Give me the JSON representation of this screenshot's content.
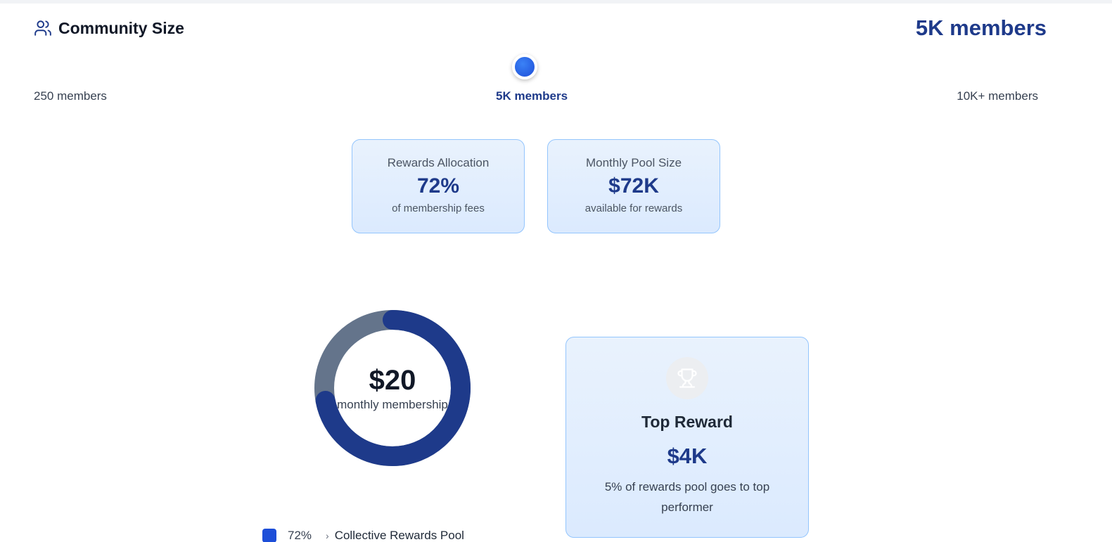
{
  "header": {
    "title": "Community Size",
    "icon": "users-icon",
    "current_value": "5K members"
  },
  "slider": {
    "min_label": "250 members",
    "mid_label": "5K members",
    "max_label": "10K+ members",
    "accent_color": "#1d4ed8"
  },
  "stats": [
    {
      "title": "Rewards Allocation",
      "value": "72%",
      "subtitle": "of membership fees"
    },
    {
      "title": "Monthly Pool Size",
      "value": "$72K",
      "subtitle": "available for rewards"
    }
  ],
  "donut": {
    "price": "$20",
    "caption": "monthly membership",
    "rewards_share": 0.72,
    "colors": {
      "rewards": "#1e3a8a",
      "other": "#64748b"
    }
  },
  "legend": [
    {
      "percent": "72%",
      "arrow": "›",
      "label": "Collective Rewards Pool",
      "color": "#1d4ed8"
    }
  ],
  "top_reward": {
    "icon": "trophy-icon",
    "title": "Top Reward",
    "value": "$4K",
    "description": "5% of rewards pool goes to top performer"
  }
}
